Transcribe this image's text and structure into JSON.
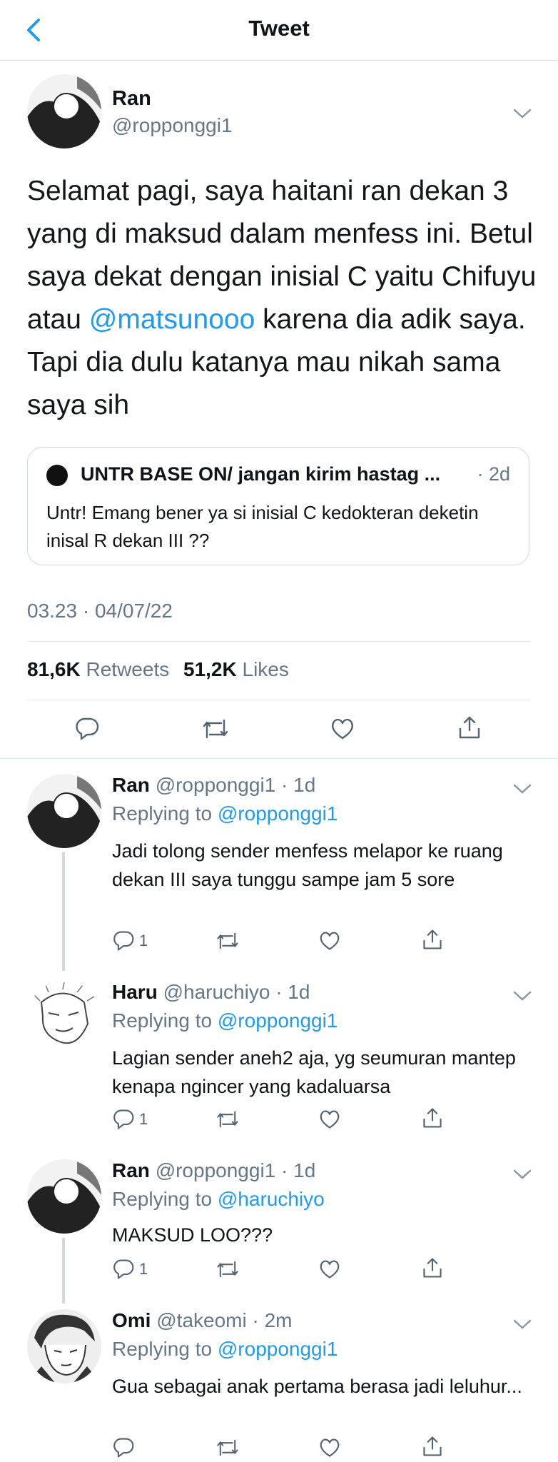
{
  "header": {
    "title": "Tweet"
  },
  "main_tweet": {
    "name": "Ran",
    "handle": "@ropponggi1",
    "text_before": "Selamat pagi, saya haitani ran dekan 3 yang di maksud dalam menfess ini. Betul saya dekat dengan inisial C yaitu Chifuyu atau ",
    "text_mention": "@matsunooo",
    "text_after": " karena dia adik saya. Tapi dia dulu katanya mau nikah sama saya sih",
    "quote": {
      "name": "UNTR BASE ON/ jangan kirim hastag ...",
      "meta": "· 2d",
      "text": "Untr! Emang bener ya si inisial C kedokteran deketin inisal R dekan III ??"
    },
    "timestamp": "03.23 · 04/07/22",
    "retweets_count": "81,6K",
    "retweets_label": "Retweets",
    "likes_count": "51,2K",
    "likes_label": "Likes"
  },
  "icons": [
    "back-chevron-icon",
    "caret-down-icon",
    "reply-icon",
    "retweet-icon",
    "like-icon",
    "share-icon"
  ],
  "colors": {
    "accent": "#1d9bf0",
    "secondary_text": "#657786"
  },
  "replies": [
    {
      "name": "Ran",
      "meta": "@ropponggi1 · 1d",
      "replying_label": "Replying to",
      "replying_to": "@ropponggi1",
      "text": "Jadi tolong sender menfess melapor ke ruang dekan III saya tunggu sampe jam 5 sore",
      "reply_count": "1"
    },
    {
      "name": "Haru",
      "meta": "@haruchiyo · 1d",
      "replying_label": "Replying to",
      "replying_to": "@ropponggi1",
      "text": "Lagian sender aneh2 aja, yg seumuran mantep kenapa ngincer yang kadaluarsa",
      "reply_count": "1"
    },
    {
      "name": "Ran",
      "meta": "@ropponggi1 · 1d",
      "replying_label": "Replying to",
      "replying_to": "@haruchiyo",
      "text": "MAKSUD LOO???",
      "reply_count": "1"
    },
    {
      "name": "Omi",
      "meta": "@takeomi · 2m",
      "replying_label": "Replying to",
      "replying_to": "@ropponggi1",
      "text": "Gua sebagai anak pertama berasa jadi leluhur...",
      "reply_count": ""
    }
  ]
}
